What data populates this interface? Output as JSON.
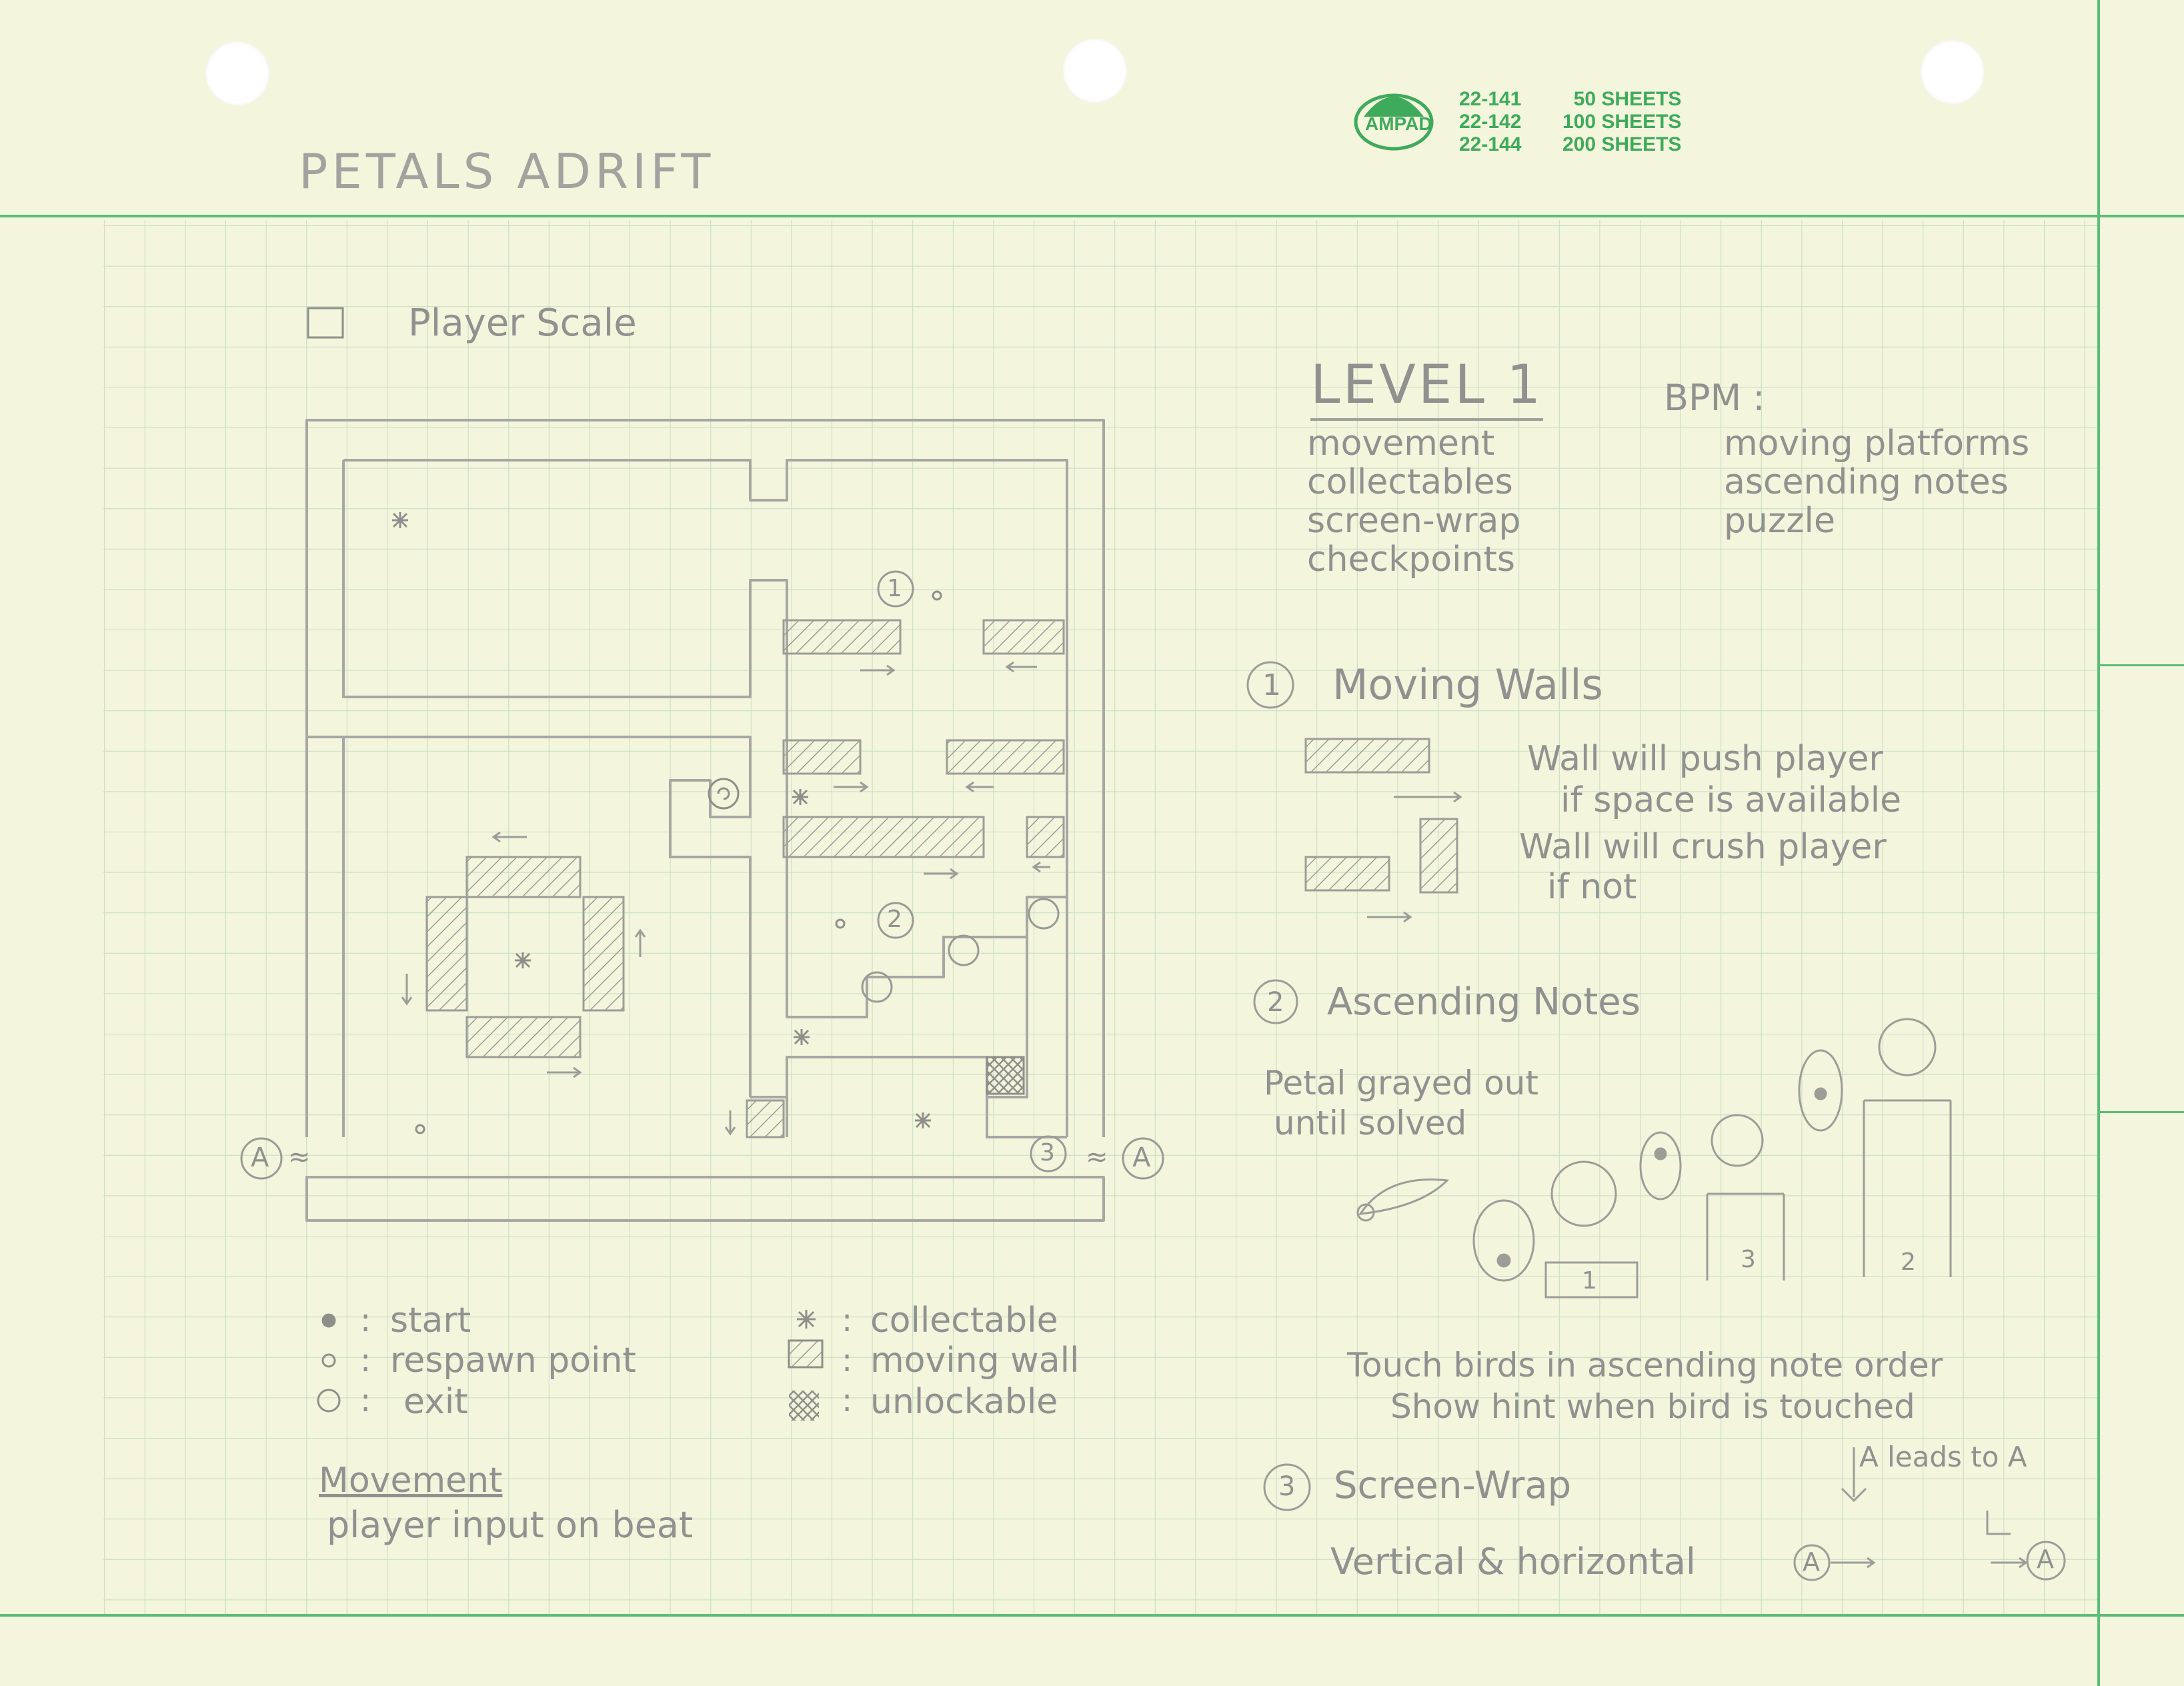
{
  "brand": {
    "logo_text": "AMPAD",
    "products": [
      {
        "code": "22-141",
        "sheets": "50 SHEETS"
      },
      {
        "code": "22-142",
        "sheets": "100 SHEETS"
      },
      {
        "code": "22-144",
        "sheets": "200 SHEETS"
      }
    ],
    "color": "#3faa5c"
  },
  "title": "PETALS ADRIFT",
  "player_scale_label": "Player Scale",
  "map": {
    "wrap_left": "A",
    "wrap_right": "A",
    "wrap_mark": "≈",
    "markers": [
      {
        "kind": "number",
        "text": "1"
      },
      {
        "kind": "number",
        "text": "2"
      },
      {
        "kind": "number",
        "text": "3"
      }
    ]
  },
  "legend": [
    {
      "symbol": "start-dot",
      "label": "start"
    },
    {
      "symbol": "respawn-circle",
      "label": "respawn point"
    },
    {
      "symbol": "exit-spiral",
      "label": "exit"
    },
    {
      "symbol": "collectable-star",
      "label": "collectable"
    },
    {
      "symbol": "moving-wall-hatch",
      "label": "moving wall"
    },
    {
      "symbol": "unlockable-crosshatch",
      "label": "unlockable"
    }
  ],
  "movement": {
    "heading": "Movement",
    "note": "player input on beat"
  },
  "level": {
    "heading": "LEVEL 1",
    "bpm_label": "BPM :",
    "features_left": [
      "movement",
      "collectables",
      "screen-wrap",
      "checkpoints"
    ],
    "features_right": [
      "moving platforms",
      "ascending notes",
      "puzzle"
    ]
  },
  "section1": {
    "number": "1",
    "heading": "Moving Walls",
    "notes": [
      "Wall will push player",
      "if space is available",
      "Wall will crush player",
      "if not"
    ]
  },
  "section2": {
    "number": "2",
    "heading": "Ascending Notes",
    "petal_note": [
      "Petal grayed out",
      "until solved"
    ],
    "pedestals": [
      "1",
      "3",
      "2"
    ],
    "notes": [
      "Touch birds in ascending note order",
      "Show hint when bird is touched"
    ]
  },
  "section3": {
    "number": "3",
    "heading": "Screen-Wrap",
    "arrow_note": "A leads to A",
    "note": "Vertical & horizontal",
    "from": "A",
    "to": "A"
  }
}
